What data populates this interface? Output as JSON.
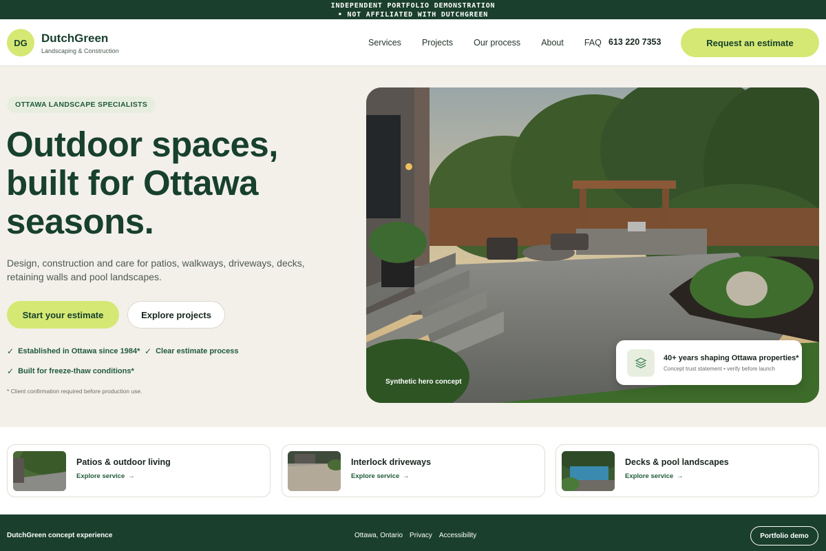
{
  "banner": {
    "line1": "INDEPENDENT PORTFOLIO DEMONSTRATION",
    "line2": "• NOT AFFILIATED WITH DUTCHGREEN"
  },
  "header": {
    "logo_initials": "DG",
    "brand_name": "DutchGreen",
    "brand_tagline": "Landscaping & Construction",
    "nav": [
      "Services",
      "Projects",
      "Our process",
      "About",
      "FAQ"
    ],
    "phone": "613 220 7353",
    "cta_label": "Request an estimate"
  },
  "hero": {
    "eyebrow": "OTTAWA LANDSCAPE SPECIALISTS",
    "headline": "Outdoor spaces, built for Ottawa seasons.",
    "subtext": "Design, construction and care for patios, walkways, driveways, decks, retaining walls and pool landscapes.",
    "primary_button": "Start your estimate",
    "secondary_button": "Explore projects",
    "checks": [
      "Established in Ottawa since 1984*",
      "Clear estimate process",
      "Built for freeze-thaw conditions*"
    ],
    "footnote": "* Client confirmation required before production use.",
    "image_caption": "Synthetic hero concept",
    "trust_title": "40+ years shaping Ottawa properties*",
    "trust_subtitle": "Concept trust statement • verify before launch"
  },
  "services": [
    {
      "title": "Patios & outdoor living",
      "link": "Explore service"
    },
    {
      "title": "Interlock driveways",
      "link": "Explore service"
    },
    {
      "title": "Decks & pool landscapes",
      "link": "Explore service"
    }
  ],
  "footer": {
    "left_text": "DutchGreen concept experience",
    "links": [
      "Ottawa, Ontario",
      "Privacy",
      "Accessibility"
    ],
    "button": "Portfolio demo"
  },
  "icons": {
    "check": "check-icon",
    "arrow": "arrow-right-icon",
    "trust": "layers-icon"
  },
  "colors": {
    "brand_dark": "#1a3f2c",
    "accent_lime": "#d5e874",
    "page_bg": "#f3f0e9"
  }
}
